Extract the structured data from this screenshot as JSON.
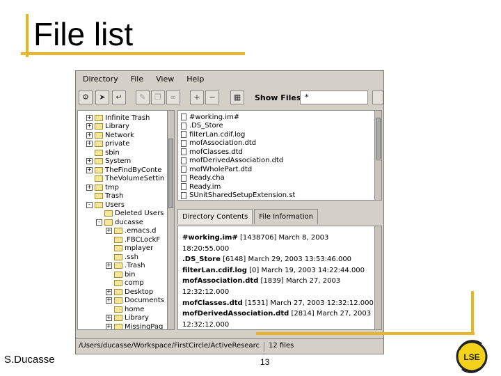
{
  "slide": {
    "title": "File list",
    "author": "S.Ducasse",
    "page_number": "13",
    "logo_text": "LSE"
  },
  "app": {
    "menu": [
      "Directory",
      "File",
      "View",
      "Help"
    ],
    "toolbar": {
      "show_files_label": "Show Files:",
      "filter_value": "*"
    },
    "tree": [
      {
        "label": "Infinite Trash",
        "expander": "+"
      },
      {
        "label": "Library",
        "expander": "+"
      },
      {
        "label": "Network",
        "expander": "+"
      },
      {
        "label": "private",
        "expander": "+"
      },
      {
        "label": "sbin",
        "expander": ""
      },
      {
        "label": "System",
        "expander": "+"
      },
      {
        "label": "TheFindByConte",
        "expander": "+"
      },
      {
        "label": "TheVolumeSettin",
        "expander": ""
      },
      {
        "label": "tmp",
        "expander": "+"
      },
      {
        "label": "Trash",
        "expander": ""
      },
      {
        "label": "Users",
        "expander": "-"
      },
      {
        "label": "Deleted Users",
        "expander": ""
      },
      {
        "label": "ducasse",
        "expander": "-"
      },
      {
        "label": ".emacs.d",
        "expander": "+"
      },
      {
        "label": ".FBCLockF",
        "expander": ""
      },
      {
        "label": "mplayer",
        "expander": ""
      },
      {
        "label": ".ssh",
        "expander": ""
      },
      {
        "label": ".Trash",
        "expander": "+"
      },
      {
        "label": "bin",
        "expander": ""
      },
      {
        "label": "comp",
        "expander": ""
      },
      {
        "label": "Desktop",
        "expander": "+"
      },
      {
        "label": "Documents",
        "expander": "+"
      },
      {
        "label": "home",
        "expander": ""
      },
      {
        "label": "Library",
        "expander": "+"
      },
      {
        "label": "MissingPag",
        "expander": "+"
      }
    ],
    "files": [
      "#working.im#",
      ".DS_Store",
      "filterLan.cdif.log",
      "mofAssociation.dtd",
      "mofClasses.dtd",
      "mofDerivedAssociation.dtd",
      "mofWholePart.dtd",
      "Ready.cha",
      "Ready.im",
      "SUnitSharedSetupExtension.st"
    ],
    "tabs": [
      "Directory Contents",
      "File Information"
    ],
    "contents": [
      {
        "name": "#working.im#",
        "info": "[1438706] March 8, 2003"
      },
      {
        "name": "",
        "info": "18:20:55.000"
      },
      {
        "name": ".DS_Store",
        "info": "[6148] March 29, 2003 13:53:46.000"
      },
      {
        "name": "filterLan.cdif.log",
        "info": "[0] March 19, 2003 14:22:44.000"
      },
      {
        "name": "mofAssociation.dtd",
        "info": "[1839] March 27, 2003"
      },
      {
        "name": "",
        "info": "12:32:12.000"
      },
      {
        "name": "mofClasses.dtd",
        "info": "[1531] March 27, 2003 12:32:12.000"
      },
      {
        "name": "mofDerivedAssociation.dtd",
        "info": "[2814] March 27, 2003"
      },
      {
        "name": "",
        "info": "12:32:12.000"
      }
    ],
    "status": {
      "path": "/Users/ducasse/Workspace/FirstCircle/ActiveResearc",
      "count": "12 files"
    }
  }
}
